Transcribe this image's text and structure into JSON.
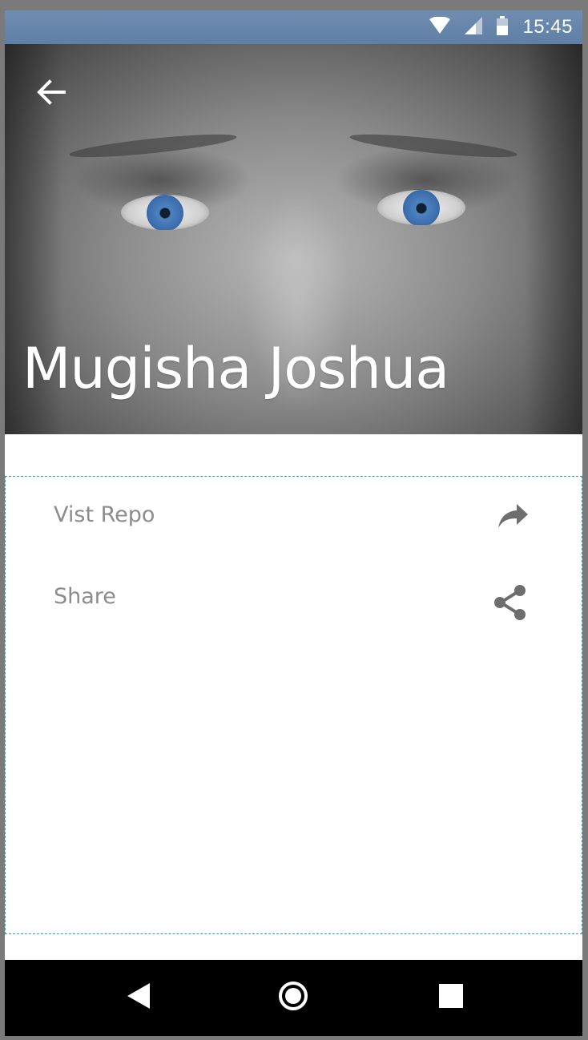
{
  "status_bar": {
    "time": "15:45",
    "icons": [
      "wifi-icon",
      "cell-signal-icon",
      "battery-icon"
    ]
  },
  "header": {
    "back_icon": "arrow-left-icon",
    "name": "Mugisha Joshua"
  },
  "actions": [
    {
      "label": "Vist Repo",
      "icon": "forward-arrow-icon"
    },
    {
      "label": "Share",
      "icon": "share-icon"
    }
  ],
  "nav_bar": {
    "buttons": [
      "nav-back-icon",
      "nav-home-icon",
      "nav-recents-icon"
    ]
  },
  "colors": {
    "status_bar": "#6785aa",
    "label_text": "#8c8c8c",
    "icon": "#6e6e6e",
    "divider": "#2aa7a7",
    "iris": "#4e82bf"
  }
}
